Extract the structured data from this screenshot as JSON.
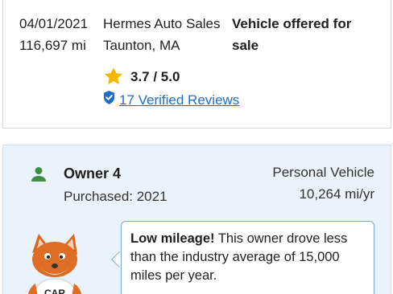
{
  "history_entry": {
    "date": "04/01/2021",
    "mileage": "116,697 mi",
    "dealer_name": "Hermes Auto Sales",
    "dealer_location": "Taunton, MA",
    "event_line1": "Vehicle offered for",
    "event_line2": "sale",
    "rating": "3.7 / 5.0",
    "reviews_link": "17 Verified Reviews"
  },
  "owner": {
    "title": "Owner 4",
    "purchased": "Purchased: 2021",
    "vehicle_type": "Personal Vehicle",
    "miles_per_year": "10,264 mi/yr"
  },
  "tip": {
    "lead": "Low mileage!",
    "line1_rest": " This owner drove less",
    "line2": "than the industry average of 15,000",
    "line3": "miles per year."
  },
  "mascot": {
    "shirt_text": "CAR"
  },
  "colors": {
    "link": "#1e6ec8",
    "star": "#f5b800",
    "owner_icon": "#3f8f3f",
    "owner_panel_bg": "#eaf3fb",
    "bubble_border": "#79a8d4"
  },
  "icons": [
    "star-icon",
    "verified-shield-icon",
    "person-icon"
  ]
}
